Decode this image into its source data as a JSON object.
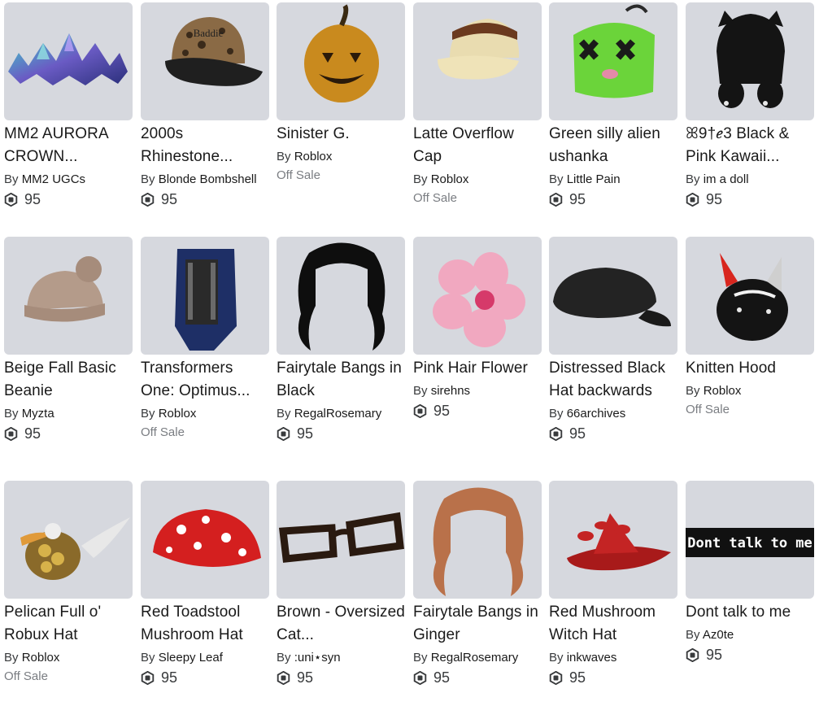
{
  "items": [
    {
      "name": "MM2 AURORA CROWN...",
      "by": "By",
      "creator": "MM2 UGCs",
      "price": "95",
      "offsale": false,
      "icon": "crown-icon"
    },
    {
      "name": "2000s Rhinestone...",
      "by": "By",
      "creator": "Blonde Bombshell",
      "price": "95",
      "offsale": false,
      "icon": "cap-icon"
    },
    {
      "name": "Sinister G.",
      "by": "By",
      "creator": "Roblox",
      "offsale_text": "Off Sale",
      "offsale": true,
      "icon": "pumpkin-icon"
    },
    {
      "name": "Latte Overflow Cap",
      "by": "By",
      "creator": "Roblox",
      "offsale_text": "Off Sale",
      "offsale": true,
      "icon": "latte-cap-icon"
    },
    {
      "name": "Green silly alien ushanka",
      "by": "By",
      "creator": "Little Pain",
      "price": "95",
      "offsale": false,
      "icon": "alien-ushanka-icon"
    },
    {
      "name": "ꕤ9†ℯ3 Black & Pink Kawaii...",
      "by": "By",
      "creator": "im a doll",
      "price": "95",
      "offsale": false,
      "icon": "kawaii-hood-icon"
    },
    {
      "name": "Beige Fall Basic Beanie",
      "by": "By",
      "creator": "Myzta",
      "price": "95",
      "offsale": false,
      "icon": "beanie-icon"
    },
    {
      "name": "Transformers One: Optimus...",
      "by": "By",
      "creator": "Roblox",
      "offsale_text": "Off Sale",
      "offsale": true,
      "icon": "optimus-helmet-icon"
    },
    {
      "name": "Fairytale Bangs in Black",
      "by": "By",
      "creator": "RegalRosemary",
      "price": "95",
      "offsale": false,
      "icon": "black-bangs-icon"
    },
    {
      "name": "Pink Hair Flower",
      "by": "By",
      "creator": "sirehns",
      "price": "95",
      "offsale": false,
      "icon": "pink-flower-icon"
    },
    {
      "name": "Distressed Black Hat backwards",
      "by": "By",
      "creator": "66archives",
      "price": "95",
      "offsale": false,
      "icon": "black-cap-icon"
    },
    {
      "name": "Knitten Hood",
      "by": "By",
      "creator": "Roblox",
      "offsale_text": "Off Sale",
      "offsale": true,
      "icon": "knitten-hood-icon"
    },
    {
      "name": "Pelican Full o' Robux Hat",
      "by": "By",
      "creator": "Roblox",
      "offsale_text": "Off Sale",
      "offsale": true,
      "icon": "pelican-hat-icon"
    },
    {
      "name": "Red Toadstool Mushroom Hat",
      "by": "By",
      "creator": "Sleepy Leaf",
      "price": "95",
      "offsale": false,
      "icon": "toadstool-hat-icon"
    },
    {
      "name": "Brown - Oversized Cat...",
      "by": "By",
      "creator": ":uni⋆syn",
      "price": "95",
      "offsale": false,
      "icon": "glasses-icon"
    },
    {
      "name": "Fairytale Bangs in Ginger",
      "by": "By",
      "creator": "RegalRosemary",
      "price": "95",
      "offsale": false,
      "icon": "ginger-bangs-icon"
    },
    {
      "name": "Red Mushroom Witch Hat",
      "by": "By",
      "creator": "inkwaves",
      "price": "95",
      "offsale": false,
      "icon": "witch-hat-icon"
    },
    {
      "name": "Dont talk to me",
      "by": "By",
      "creator": "Az0te",
      "price": "95",
      "offsale": false,
      "icon": "dont-talk-sign-icon",
      "sign_text": "Dont talk to me"
    }
  ],
  "colors": {
    "thumb_bg": "#d6d8de",
    "text": "#1a1a1a",
    "muted": "#7a7d82"
  }
}
